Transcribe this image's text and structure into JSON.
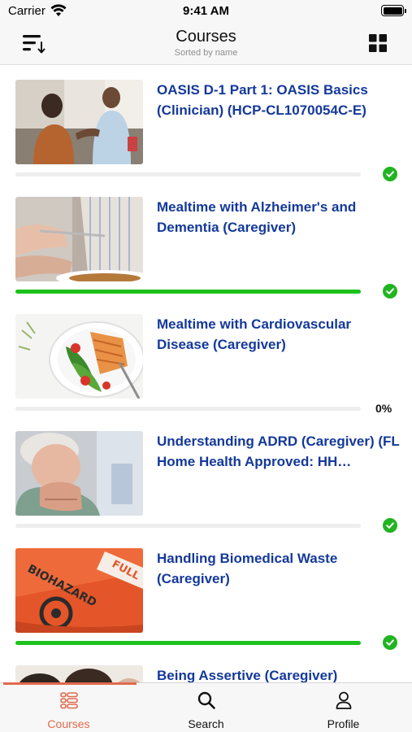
{
  "status_bar": {
    "carrier": "Carrier",
    "time": "9:41 AM"
  },
  "nav": {
    "title": "Courses",
    "subtitle": "Sorted by name",
    "left_icon": "sort-icon",
    "right_icon": "grid-view-icon"
  },
  "courses": [
    {
      "title": "OASIS D-1 Part 1: OASIS Basics (Clinician) (HCP-CL1070054C-E)",
      "progress": 0,
      "status": "complete",
      "status_label": "",
      "thumbnail": "nurse-with-elderly-patient-photo"
    },
    {
      "title": "Mealtime with Alzheimer's and Dementia (Caregiver)",
      "progress": 1,
      "status": "complete",
      "status_label": "",
      "thumbnail": "elderly-hands-eating-photo"
    },
    {
      "title": "Mealtime with Cardiovascular Disease (Caregiver)",
      "progress": 0,
      "status": "percent",
      "status_label": "0%",
      "thumbnail": "salmon-salad-plate-photo"
    },
    {
      "title": "Understanding ADRD (Caregiver) (FL Home Health Approved: HH…",
      "progress": 0,
      "status": "complete",
      "status_label": "",
      "thumbnail": "worried-elderly-woman-photo"
    },
    {
      "title": "Handling Biomedical Waste (Caregiver)",
      "progress": 1,
      "status": "complete",
      "status_label": "",
      "thumbnail": "biohazard-bag-photo"
    },
    {
      "title": "Being Assertive (Caregiver)",
      "progress": 0,
      "status": "none",
      "status_label": "",
      "thumbnail": "people-photo"
    }
  ],
  "tabs": [
    {
      "label": "Courses",
      "icon": "courses-list-icon",
      "active": true
    },
    {
      "label": "Search",
      "icon": "search-icon",
      "active": false
    },
    {
      "label": "Profile",
      "icon": "profile-icon",
      "active": false
    }
  ],
  "colors": {
    "title_blue": "#14399a",
    "progress_green": "#1cc21c",
    "check_green": "#22b422",
    "tab_active": "#e06a4c",
    "track_gray": "#eeeeee"
  }
}
